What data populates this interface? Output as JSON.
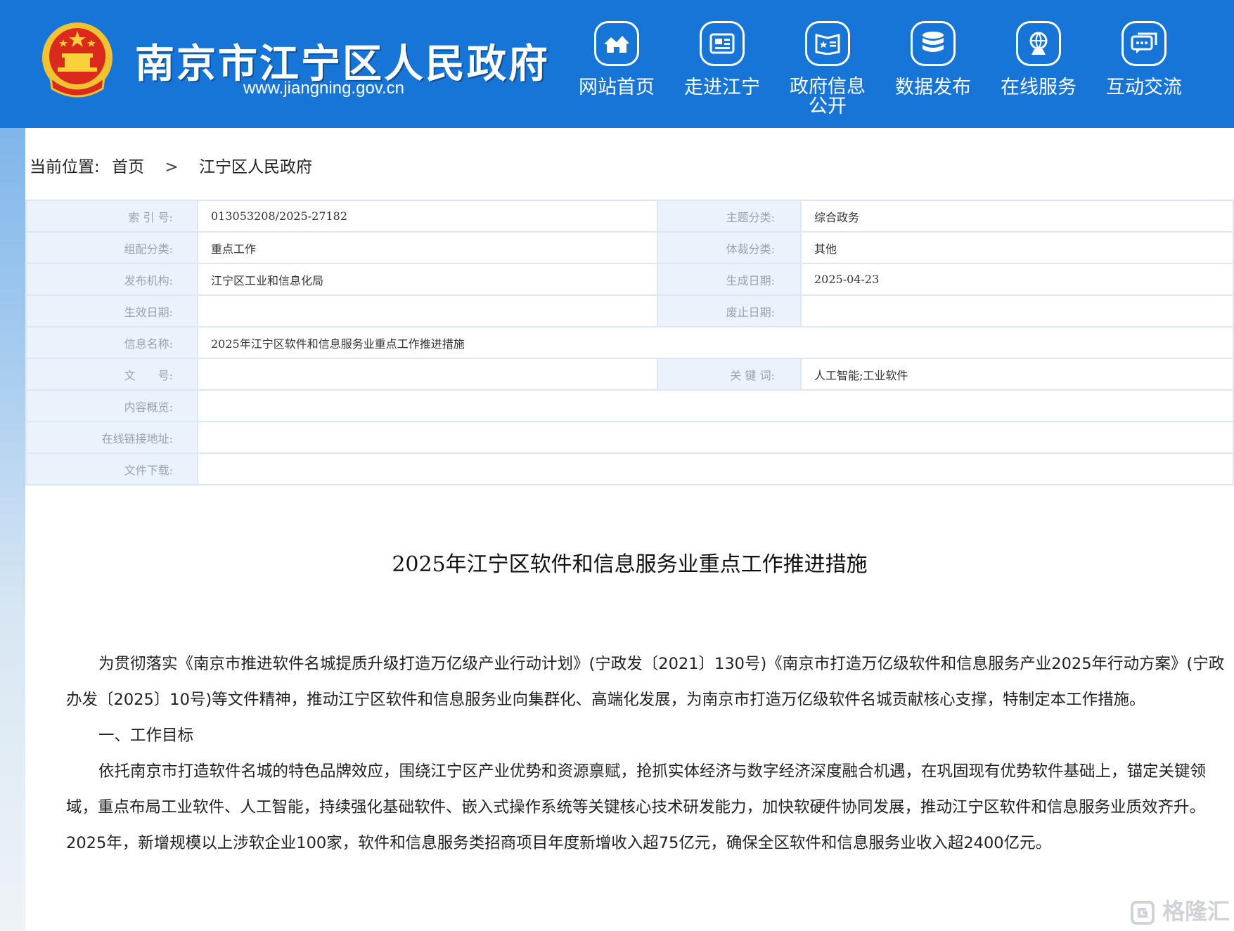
{
  "header": {
    "site_title": "南京市江宁区人民政府",
    "site_url": "www.jiangning.gov.cn",
    "nav": [
      {
        "label": "网站首页",
        "icon": "houses-icon"
      },
      {
        "label": "走进江宁",
        "icon": "newspaper-icon"
      },
      {
        "label": "政府信息公开",
        "icon": "open-book-icon"
      },
      {
        "label": "数据发布",
        "icon": "database-icon"
      },
      {
        "label": "在线服务",
        "icon": "globe-person-icon"
      },
      {
        "label": "互动交流",
        "icon": "chat-bubbles-icon"
      }
    ]
  },
  "breadcrumb": {
    "prefix": "当前位置:",
    "items": [
      "首页",
      "江宁区人民政府"
    ],
    "separator": ">"
  },
  "info": {
    "index_label": "索 引 号:",
    "index_value": "013053208/2025-27182",
    "topic_label": "主题分类:",
    "topic_value": "综合政务",
    "org_class_label": "组配分类:",
    "org_class_value": "重点工作",
    "genre_label": "体裁分类:",
    "genre_value": "其他",
    "publisher_label": "发布机构:",
    "publisher_value": "江宁区工业和信息化局",
    "created_label": "生成日期:",
    "created_value": "2025-04-23",
    "effective_label": "生效日期:",
    "effective_value": "",
    "abolished_label": "废止日期:",
    "abolished_value": "",
    "name_label": "信息名称:",
    "name_value": "2025年江宁区软件和信息服务业重点工作推进措施",
    "docno_label": "文　　号:",
    "docno_value": "",
    "keywords_label": "关 键 词:",
    "keywords_value": "人工智能;工业软件",
    "summary_label": "内容概览:",
    "summary_value": "",
    "link_label": "在线链接地址:",
    "link_value": "",
    "download_label": "文件下载:",
    "download_value": ""
  },
  "article": {
    "title": "2025年江宁区软件和信息服务业重点工作推进措施",
    "paragraphs": [
      "为贯彻落实《南京市推进软件名城提质升级打造万亿级产业行动计划》(宁政发〔2021〕130号)《南京市打造万亿级软件和信息服务产业2025年行动方案》(宁政办发〔2025〕10号)等文件精神，推动江宁区软件和信息服务业向集群化、高端化发展，为南京市打造万亿级软件名城贡献核心支撑，特制定本工作措施。",
      "一、工作目标",
      "依托南京市打造软件名城的特色品牌效应，围绕江宁区产业优势和资源禀赋，抢抓实体经济与数字经济深度融合机遇，在巩固现有优势软件基础上，锚定关键领域，重点布局工业软件、人工智能，持续强化基础软件、嵌入式操作系统等关键核心技术研发能力，加快软硬件协同发展，推动江宁区软件和信息服务业质效齐升。2025年，新增规模以上涉软企业100家，软件和信息服务类招商项目年度新增收入超75亿元，确保全区软件和信息服务业收入超2400亿元。"
    ]
  },
  "watermark": "格隆汇",
  "colors": {
    "header_blue": "#1775d8",
    "label_bg": "#eaf2fb",
    "border": "#dde8f3"
  }
}
